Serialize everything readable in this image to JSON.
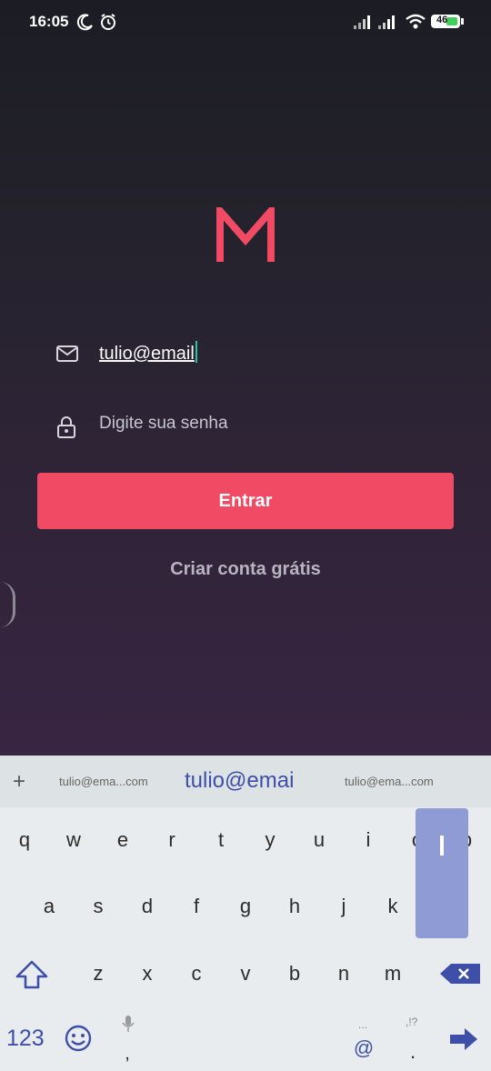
{
  "status_bar": {
    "time": "16:05",
    "battery": "46",
    "icons": [
      "moon-icon",
      "alarm-icon",
      "signal-icon",
      "signal-icon",
      "wifi-icon",
      "battery-icon"
    ]
  },
  "app": {
    "logo_letter": "M",
    "colors": {
      "accent": "#f14a64"
    },
    "email_value": "tulio@email",
    "password_placeholder": "Digite sua senha",
    "login_button": "Entrar",
    "signup_link": "Criar conta grátis"
  },
  "keyboard": {
    "suggestions": [
      "tulio@ema...com",
      "tulio@emai",
      "tulio@ema...com"
    ],
    "row1": [
      "q",
      "w",
      "e",
      "r",
      "t",
      "y",
      "u",
      "i",
      "o",
      "p"
    ],
    "row2": [
      "a",
      "s",
      "d",
      "f",
      "g",
      "h",
      "j",
      "k"
    ],
    "row3": [
      "z",
      "x",
      "c",
      "v",
      "b",
      "n",
      "m"
    ],
    "mode_key": "123",
    "at_key": "@",
    "comma_key": ",",
    "period_key": ".",
    "punct_hint": ",!?",
    "ellipsis_hint": "..."
  }
}
